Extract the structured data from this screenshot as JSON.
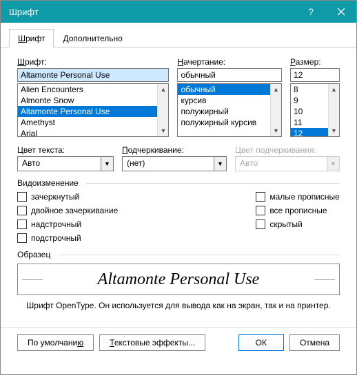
{
  "titlebar": {
    "title": "Шрифт"
  },
  "tabs": {
    "font": "Шрифт",
    "advanced": "Дополнительно"
  },
  "labels": {
    "font": "Шрифт:",
    "style": "Начертание:",
    "size": "Размер:",
    "color": "Цвет текста:",
    "underline": "Подчеркивание:",
    "underline_color": "Цвет подчеркивания:",
    "effects": "Видоизменение",
    "sample": "Образец"
  },
  "font_input": "Altamonte Personal Use",
  "font_list": [
    "Alien Encounters",
    "Almonte Snow",
    "Altamonte Personal Use",
    "Amethyst",
    "Arial"
  ],
  "font_selected_index": 2,
  "style_input": "обычный",
  "style_list": [
    "обычный",
    "курсив",
    "полужирный",
    "полужирный курсив"
  ],
  "style_selected_index": 0,
  "size_input": "12",
  "size_list": [
    "8",
    "9",
    "10",
    "11",
    "12"
  ],
  "size_selected_index": 4,
  "color_value": "Авто",
  "underline_value": "(нет)",
  "underline_color_value": "Авто",
  "checks_left": [
    "зачеркнутый",
    "двойное зачеркивание",
    "надстрочный",
    "подстрочный"
  ],
  "checks_right": [
    "малые прописные",
    "все прописные",
    "скрытый"
  ],
  "preview_text": "Altamonte Personal Use",
  "note": "Шрифт OpenType. Он используется для вывода как на экран, так и на принтер.",
  "buttons": {
    "default": "По умолчанию",
    "text_effects": "Текстовые эффекты...",
    "ok": "ОК",
    "cancel": "Отмена"
  }
}
